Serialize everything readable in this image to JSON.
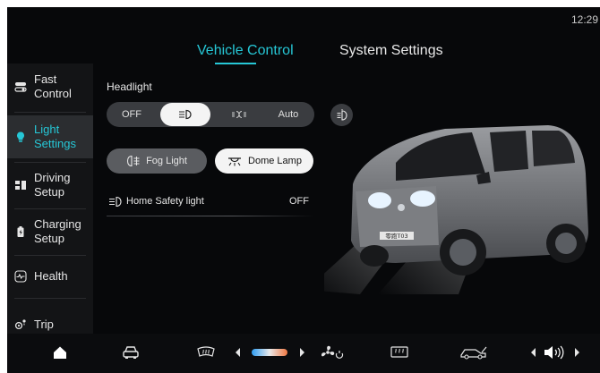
{
  "status_bar": {
    "time": "12:29"
  },
  "tabs": [
    {
      "label": "Vehicle Control",
      "active": true
    },
    {
      "label": "System Settings",
      "active": false
    }
  ],
  "sidebar": {
    "items": [
      {
        "label": "Fast\nControl",
        "icon": "toggle-icon",
        "active": false
      },
      {
        "label": "Light\nSettings",
        "icon": "bulb-icon",
        "active": true
      },
      {
        "label": "Driving\nSetup",
        "icon": "steering-icon",
        "active": false
      },
      {
        "label": "Charging\nSetup",
        "icon": "battery-charge-icon",
        "active": false
      },
      {
        "label": "Health",
        "icon": "health-pulse-icon",
        "active": false
      },
      {
        "label": "Trip",
        "icon": "location-icon",
        "active": false
      }
    ]
  },
  "headlight": {
    "title": "Headlight",
    "options": [
      {
        "label": "OFF",
        "selected": false
      },
      {
        "label": "low-beam-icon",
        "selected": true
      },
      {
        "label": "parking-light-icon",
        "selected": false
      },
      {
        "label": "Auto",
        "selected": false
      }
    ],
    "high_beam_icon": "high-beam-icon"
  },
  "fog_light": {
    "label": "Fog Light",
    "state": "off"
  },
  "dome_lamp": {
    "label": "Dome Lamp",
    "state": "on"
  },
  "home_safety": {
    "label": "Home Safety light",
    "value": "OFF"
  },
  "vehicle": {
    "plate": "零跑T03"
  },
  "colors": {
    "accent": "#26c7d6",
    "background": "#07080a",
    "sidebar": "#131416"
  },
  "bottom_bar": {
    "icons": [
      "home-icon",
      "car-icon",
      "rear-defrost-icon",
      "temperature-slider-icon",
      "fan-icon",
      "front-defrost-icon",
      "car-door-icon",
      "volume-icon"
    ]
  }
}
